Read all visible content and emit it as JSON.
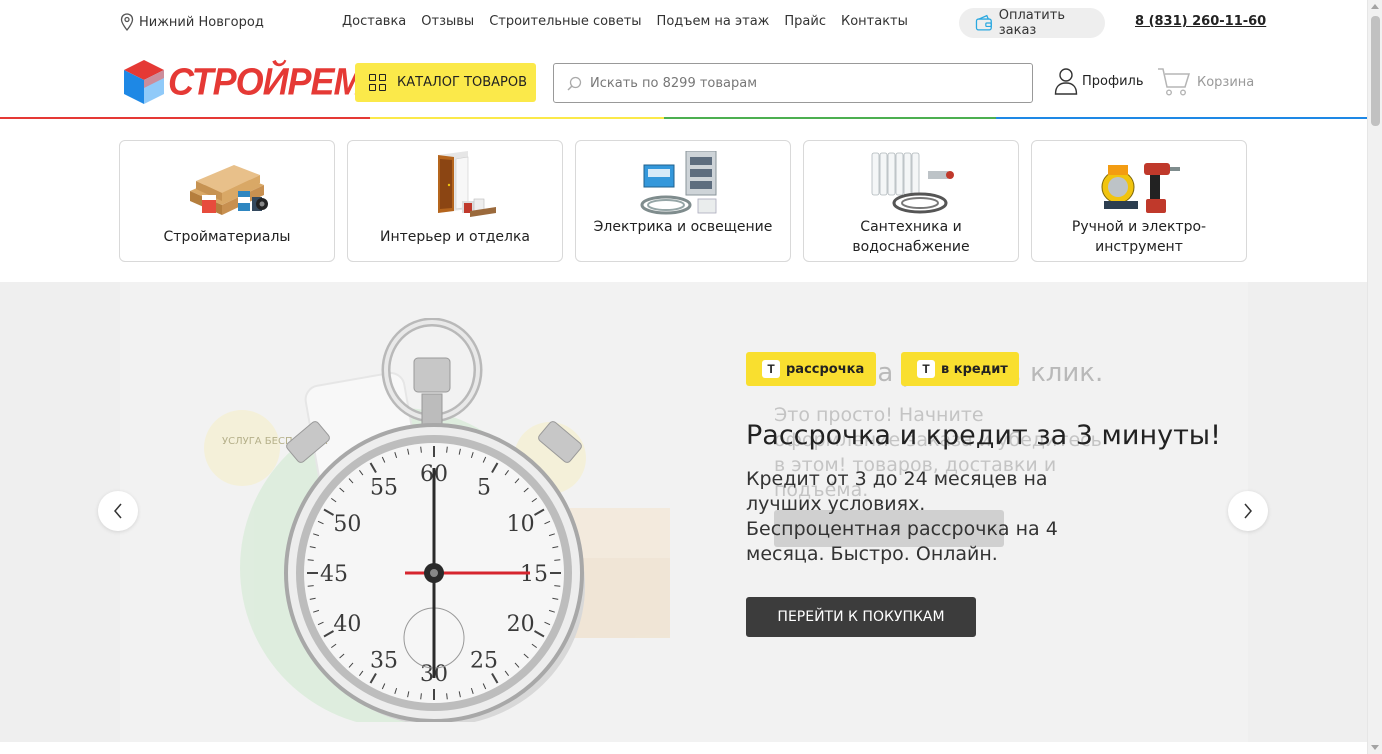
{
  "topbar": {
    "city": "Нижний Новгород",
    "nav": [
      "Доставка",
      "Отзывы",
      "Строительные советы",
      "Подъем на этаж",
      "Прайс",
      "Контакты"
    ],
    "pay_label": "Оплатить заказ",
    "phone": "8 (831) 260-11-60"
  },
  "header": {
    "logo_text": "СТРОЙРЕМ",
    "catalog_label": "КАТАЛОГ ТОВАРОВ",
    "search_placeholder": "Искать по 8299 товарам",
    "profile_label": "Профиль",
    "cart_label": "Корзина",
    "line_colors": [
      "#e53935",
      "#fbe94a",
      "#4caf50",
      "#1e88e5"
    ]
  },
  "categories": [
    {
      "label": "Стройматериалы",
      "icon": "lumber-icon"
    },
    {
      "label": "Интерьер и отделка",
      "icon": "door-icon"
    },
    {
      "label": "Электрика и освещение",
      "icon": "electrical-icon"
    },
    {
      "label": "Сантехника и водоснабжение",
      "icon": "radiator-icon"
    },
    {
      "label": "Ручной и электро-инструмент",
      "icon": "power-tools-icon"
    }
  ],
  "banner": {
    "ghost_title": "Заказ на раз, два, клик.",
    "ghost_text": "Это просто! Начните оформление заказа и убедитесь в этом! товаров, доставки и подъёма.",
    "badge_installment": "рассрочка",
    "badge_credit": "в кредит",
    "badge_logo_letter": "Т",
    "title": "Рассрочка и кредит за 3 минуты!",
    "text": "Кредит от 3 до 24 месяцев на лучших условиях. Беспроцентная рассрочка на 4 месяца. Быстро. Онлайн.",
    "button_label": "ПЕРЕЙТИ К ПОКУПКАМ",
    "stamp_text": "УСЛУГА БЕСПЛАТНА",
    "dial_numbers": [
      "60",
      "5",
      "10",
      "15",
      "20",
      "25",
      "30",
      "35",
      "40",
      "45",
      "50",
      "55"
    ],
    "accent_color": "#f9df2f"
  }
}
